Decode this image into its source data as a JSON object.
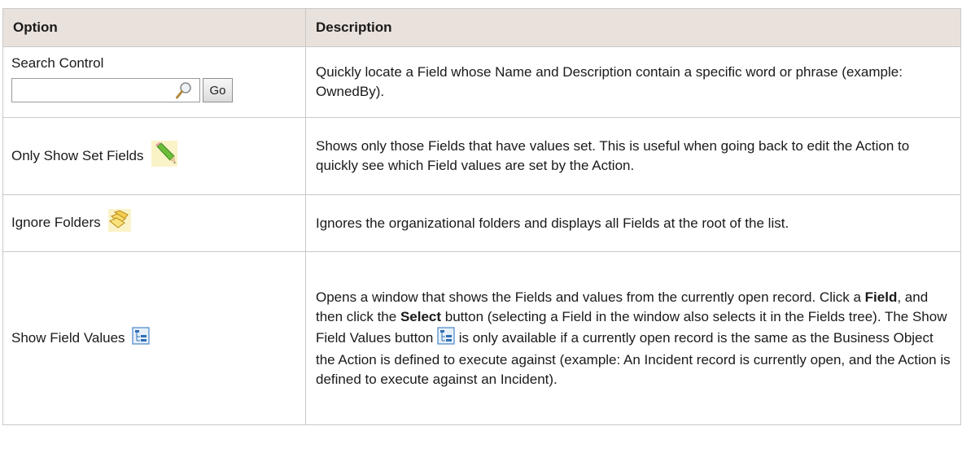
{
  "table": {
    "headers": {
      "option": "Option",
      "description": "Description"
    },
    "search": {
      "label": "Search Control",
      "input_value": "",
      "go_label": "Go",
      "description": "Quickly locate a Field whose Name and Description contain a specific word or phrase (example: OwnedBy)."
    },
    "only_show_set": {
      "label": "Only Show Set Fields",
      "icon": "pencil-icon",
      "description": "Shows only those Fields that have values set. This is useful when going back to edit the Action to quickly see which Field values are set by the Action."
    },
    "ignore_folders": {
      "label": "Ignore Folders",
      "icon": "folders-icon",
      "description": "Ignores the organizational folders and displays all Fields at the root of the list."
    },
    "show_field_values": {
      "label": "Show Field Values",
      "icon": "field-values-icon",
      "desc_part1": "Opens a window that shows the Fields and values from the currently open record. Click a ",
      "desc_bold1": "Field",
      "desc_part2": ", and then click the ",
      "desc_bold2": "Select",
      "desc_part3": " button (selecting a Field in the window also selects it in the Fields tree). The Show Field Values button ",
      "desc_part4": " is only available if a currently open record is the same as the Business Object the Action is defined to execute against (example: An Incident record is currently open, and the Action is defined to execute against an Incident)."
    }
  }
}
